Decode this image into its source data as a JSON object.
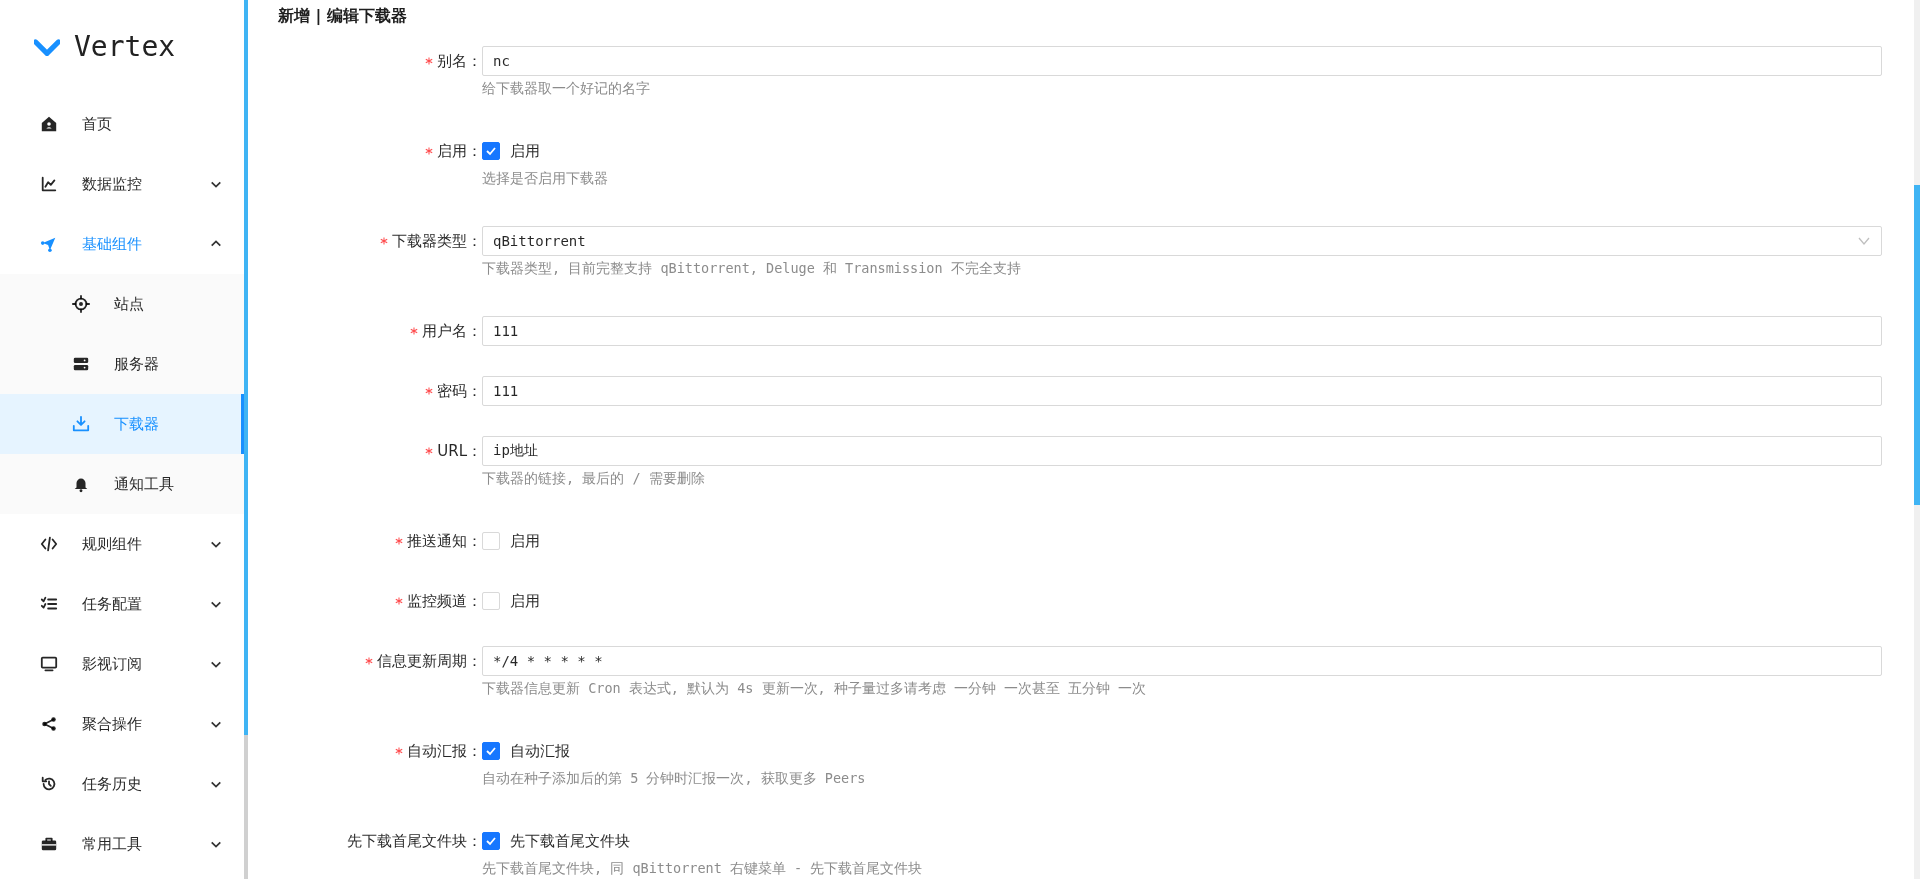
{
  "sidebar": {
    "logo": "Vertex",
    "items": [
      {
        "label": "首页",
        "selected": false
      },
      {
        "label": "数据监控",
        "selected": false,
        "expanded": false
      },
      {
        "label": "基础组件",
        "selected": false,
        "expanded": true,
        "children": [
          {
            "label": "站点",
            "selected": false
          },
          {
            "label": "服务器",
            "selected": false
          },
          {
            "label": "下载器",
            "selected": true
          },
          {
            "label": "通知工具",
            "selected": false
          }
        ]
      },
      {
        "label": "规则组件",
        "selected": false,
        "expanded": false
      },
      {
        "label": "任务配置",
        "selected": false,
        "expanded": false
      },
      {
        "label": "影视订阅",
        "selected": false,
        "expanded": false
      },
      {
        "label": "聚合操作",
        "selected": false,
        "expanded": false
      },
      {
        "label": "任务历史",
        "selected": false,
        "expanded": false
      },
      {
        "label": "常用工具",
        "selected": false,
        "expanded": false
      }
    ]
  },
  "form": {
    "title": "新增 | 编辑下载器",
    "fields": [
      {
        "kind": "text",
        "required": true,
        "label": "别名：",
        "value": "nc",
        "help": "给下载器取一个好记的名字"
      },
      {
        "kind": "checkbox",
        "required": true,
        "label": "启用：",
        "checked": true,
        "option": "启用",
        "help": "选择是否启用下载器"
      },
      {
        "kind": "select",
        "required": true,
        "label": "下载器类型：",
        "value": "qBittorrent",
        "help": "下载器类型, 目前完整支持 qBittorrent, Deluge 和 Transmission 不完全支持"
      },
      {
        "kind": "text",
        "required": true,
        "label": "用户名：",
        "value": "111"
      },
      {
        "kind": "text",
        "required": true,
        "label": "密码：",
        "value": "111"
      },
      {
        "kind": "text",
        "required": true,
        "label": "URL：",
        "value": "ip地址",
        "help": "下载器的链接, 最后的 / 需要删除"
      },
      {
        "kind": "checkbox",
        "required": true,
        "label": "推送通知：",
        "checked": false,
        "option": "启用"
      },
      {
        "kind": "checkbox",
        "required": true,
        "label": "监控频道：",
        "checked": false,
        "option": "启用"
      },
      {
        "kind": "text",
        "required": true,
        "label": "信息更新周期：",
        "value": "*/4 * * * * *",
        "help": "下载器信息更新 Cron 表达式, 默认为 4s 更新一次, 种子量过多请考虑 一分钟 一次甚至 五分钟 一次"
      },
      {
        "kind": "checkbox",
        "required": true,
        "label": "自动汇报：",
        "checked": true,
        "option": "自动汇报",
        "help": "自动在种子添加后的第 5 分钟时汇报一次, 获取更多 Peers"
      },
      {
        "kind": "checkbox",
        "required": false,
        "label": "先下载首尾文件块：",
        "checked": true,
        "option": "先下载首尾文件块",
        "help": "先下载首尾文件块, 同 qBittorrent 右键菜单 - 先下载首尾文件块"
      }
    ]
  }
}
